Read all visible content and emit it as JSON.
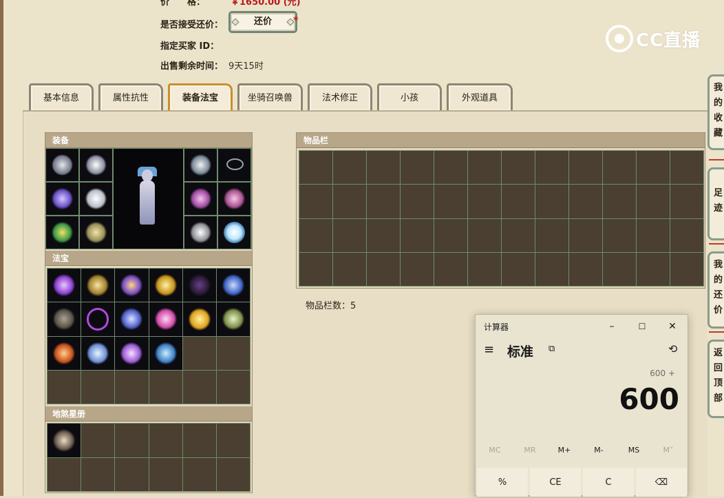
{
  "listing": {
    "price_label": "价　　格：",
    "price_value": "￥1650.00 (元)",
    "haggle_label": "是否接受还价：",
    "haggle_button": "还价",
    "required_mark": "*",
    "buyer_label": "指定买家 ID：",
    "buyer_value": "",
    "time_label": "出售剩余时间：",
    "time_value": "9天15时"
  },
  "logo": {
    "text": "CC直播"
  },
  "tabs": [
    {
      "label": "基本信息",
      "active": false
    },
    {
      "label": "属性抗性",
      "active": false
    },
    {
      "label": "装备法宝",
      "active": true
    },
    {
      "label": "坐骑召唤兽",
      "active": false
    },
    {
      "label": "法术修正",
      "active": false
    },
    {
      "label": "小孩",
      "active": false
    },
    {
      "label": "外观道具",
      "active": false
    }
  ],
  "equipment": {
    "header": "装备",
    "items": [
      "whip",
      "horn",
      "gloves",
      "robe",
      "charm",
      "boots",
      "ribbon",
      "necklace",
      "pendant-pink",
      "earring-pink",
      "ring-silver",
      "pearl-orb"
    ]
  },
  "treasure": {
    "header": "法宝",
    "items": [
      "violet-box",
      "golden-tablet",
      "orb-staff",
      "golden-pagoda",
      "dark-mirror",
      "azure-gauntlet",
      "stone-slab",
      "purple-whip",
      "blue-scroll",
      "pink-lantern",
      "golden-flower",
      "jade-tablet",
      "flame-shard",
      "frost-gauntlet",
      "crystal-flower",
      "sapphire-amulet"
    ],
    "empty_slots": 8
  },
  "constellation": {
    "header": "地煞星册",
    "items": [
      "armored-warrior"
    ],
    "empty_slots": 11
  },
  "inventory": {
    "header": "物品栏",
    "slots": 48,
    "count_label": "物品栏数：5"
  },
  "side_buttons": [
    {
      "label": "我的收藏",
      "chars": [
        "我",
        "的",
        "收",
        "藏"
      ]
    },
    {
      "label": "足迹",
      "chars": [
        "足",
        "迹"
      ]
    },
    {
      "label": "我的还价",
      "chars": [
        "我",
        "的",
        "还",
        "价"
      ]
    },
    {
      "label": "返回顶部",
      "chars": [
        "返",
        "回",
        "顶",
        "部"
      ]
    }
  ],
  "calculator": {
    "title": "计算器",
    "minimize": "–",
    "maximize": "☐",
    "close": "✕",
    "menu_icon": "≡",
    "mode": "标准",
    "keep_on_top_icon": "⧉",
    "history_icon": "⟲",
    "expression": "600 +",
    "display": "600",
    "memory": [
      {
        "label": "MC",
        "enabled": false
      },
      {
        "label": "MR",
        "enabled": false
      },
      {
        "label": "M+",
        "enabled": true
      },
      {
        "label": "M-",
        "enabled": true
      },
      {
        "label": "MS",
        "enabled": true
      },
      {
        "label": "M˅",
        "enabled": false
      }
    ],
    "keys": [
      "%",
      "CE",
      "C",
      "⌫"
    ]
  },
  "colors": {
    "price": "#b51c1c",
    "active_tab_border": "#c98f2a",
    "panel_header": "#b7a688",
    "grid_line": "#6f8b6e",
    "slot_bg": "#4a3f30"
  }
}
